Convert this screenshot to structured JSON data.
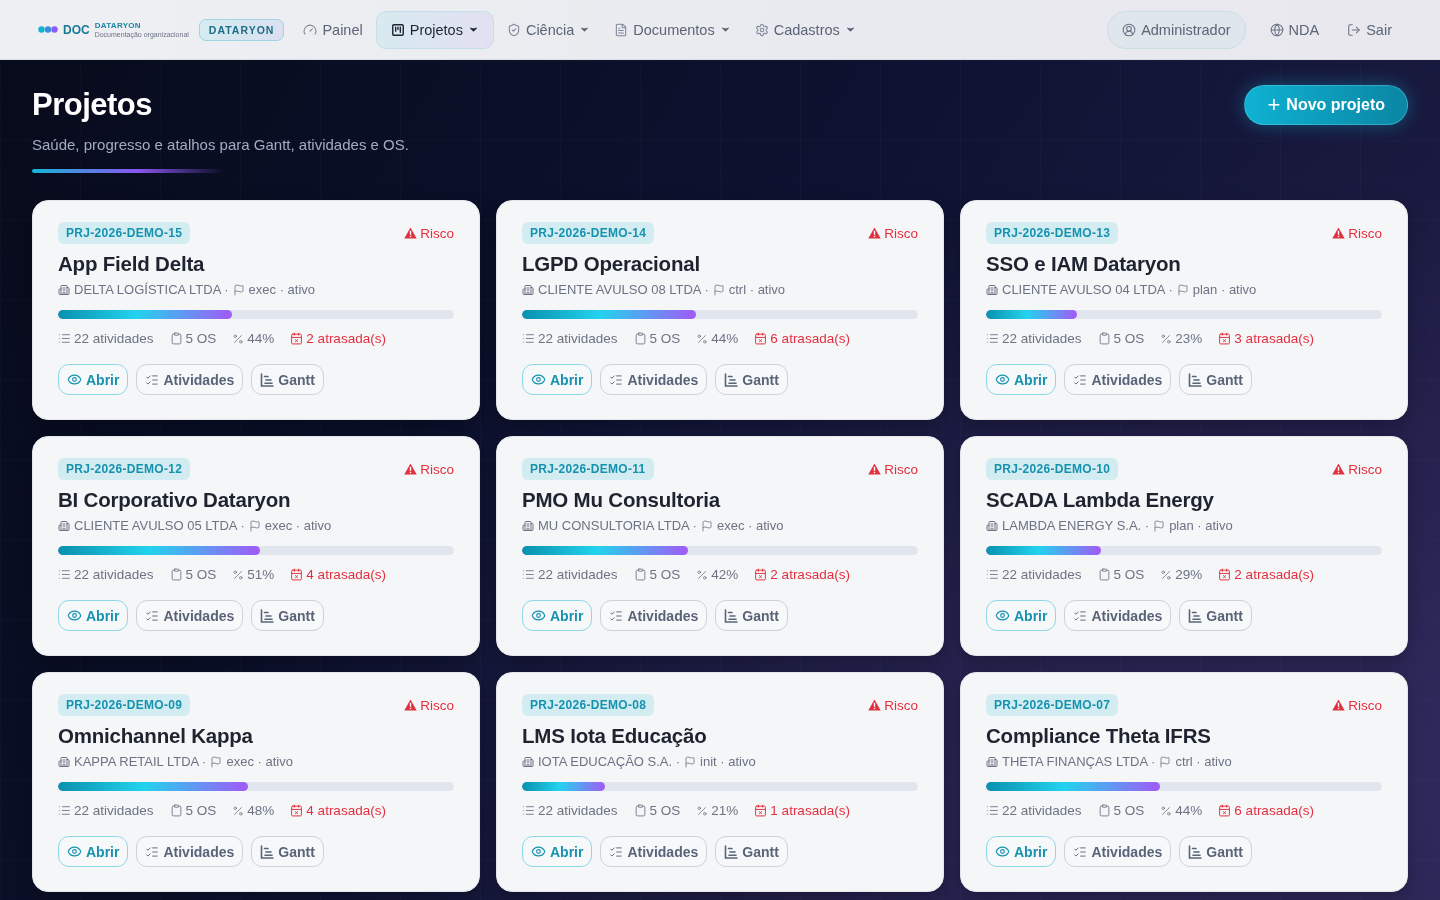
{
  "header": {
    "logo": {
      "wordmark": "DOC",
      "brand": "DATARYON",
      "tagline": "Documentação organizacional"
    },
    "badge": "DATARYON",
    "nav": [
      {
        "label": "Painel",
        "kind": "dashboard",
        "selected": false,
        "dropdown": false
      },
      {
        "label": "Projetos",
        "kind": "projects",
        "selected": true,
        "dropdown": true
      },
      {
        "label": "Ciência",
        "kind": "science",
        "selected": false,
        "dropdown": true
      },
      {
        "label": "Documentos",
        "kind": "documents",
        "selected": false,
        "dropdown": true
      },
      {
        "label": "Cadastros",
        "kind": "settings",
        "selected": false,
        "dropdown": true
      }
    ],
    "account": [
      {
        "label": "Administrador",
        "kind": "user"
      },
      {
        "label": "NDA",
        "kind": "globe"
      },
      {
        "label": "Sair",
        "kind": "logout"
      }
    ]
  },
  "page": {
    "title": "Projetos",
    "subtitle": "Saúde, progresso e atalhos para Gantt, atividades e OS.",
    "new_button": {
      "icon": "+",
      "label": "Novo projeto"
    }
  },
  "projects": [
    {
      "code": "PRJ-2026-DEMO-15",
      "risk": "Risco",
      "title": "App Field Delta",
      "client": "DELTA LOGÍSTICA LTDA ·",
      "stage": "exec · ativo",
      "level": 0.44,
      "activities": "22 atividades",
      "os": "5 OS",
      "percent": "44%",
      "late": "2 atrasada(s)",
      "actions": [
        {
          "label": "Abrir",
          "kind": "view"
        },
        {
          "label": "Atividades",
          "kind": "tasks"
        },
        {
          "label": "Gantt",
          "kind": "gantt"
        }
      ]
    },
    {
      "code": "PRJ-2026-DEMO-14",
      "risk": "Risco",
      "title": "LGPD Operacional",
      "client": "CLIENTE AVULSO 08 LTDA ·",
      "stage": "ctrl · ativo",
      "level": 0.44,
      "activities": "22 atividades",
      "os": "5 OS",
      "percent": "44%",
      "late": "6 atrasada(s)",
      "actions": [
        {
          "label": "Abrir",
          "kind": "view"
        },
        {
          "label": "Atividades",
          "kind": "tasks"
        },
        {
          "label": "Gantt",
          "kind": "gantt"
        }
      ]
    },
    {
      "code": "PRJ-2026-DEMO-13",
      "risk": "Risco",
      "title": "SSO e IAM Dataryon",
      "client": "CLIENTE AVULSO 04 LTDA ·",
      "stage": "plan · ativo",
      "level": 0.23,
      "activities": "22 atividades",
      "os": "5 OS",
      "percent": "23%",
      "late": "3 atrasada(s)",
      "actions": [
        {
          "label": "Abrir",
          "kind": "view"
        },
        {
          "label": "Atividades",
          "kind": "tasks"
        },
        {
          "label": "Gantt",
          "kind": "gantt"
        }
      ]
    },
    {
      "code": "PRJ-2026-DEMO-12",
      "risk": "Risco",
      "title": "BI Corporativo Dataryon",
      "client": "CLIENTE AVULSO 05 LTDA ·",
      "stage": "exec · ativo",
      "level": 0.51,
      "activities": "22 atividades",
      "os": "5 OS",
      "percent": "51%",
      "late": "4 atrasada(s)",
      "actions": [
        {
          "label": "Abrir",
          "kind": "view"
        },
        {
          "label": "Atividades",
          "kind": "tasks"
        },
        {
          "label": "Gantt",
          "kind": "gantt"
        }
      ]
    },
    {
      "code": "PRJ-2026-DEMO-11",
      "risk": "Risco",
      "title": "PMO Mu Consultoria",
      "client": "MU CONSULTORIA LTDA ·",
      "stage": "exec · ativo",
      "level": 0.42,
      "activities": "22 atividades",
      "os": "5 OS",
      "percent": "42%",
      "late": "2 atrasada(s)",
      "actions": [
        {
          "label": "Abrir",
          "kind": "view"
        },
        {
          "label": "Atividades",
          "kind": "tasks"
        },
        {
          "label": "Gantt",
          "kind": "gantt"
        }
      ]
    },
    {
      "code": "PRJ-2026-DEMO-10",
      "risk": "Risco",
      "title": "SCADA Lambda Energy",
      "client": "LAMBDA ENERGY S.A. ·",
      "stage": "plan · ativo",
      "level": 0.29,
      "activities": "22 atividades",
      "os": "5 OS",
      "percent": "29%",
      "late": "2 atrasada(s)",
      "actions": [
        {
          "label": "Abrir",
          "kind": "view"
        },
        {
          "label": "Atividades",
          "kind": "tasks"
        },
        {
          "label": "Gantt",
          "kind": "gantt"
        }
      ]
    },
    {
      "code": "PRJ-2026-DEMO-09",
      "risk": "Risco",
      "title": "Omnichannel Kappa",
      "client": "KAPPA RETAIL LTDA ·",
      "stage": "exec · ativo",
      "level": 0.48,
      "activities": "22 atividades",
      "os": "5 OS",
      "percent": "48%",
      "late": "4 atrasada(s)",
      "actions": [
        {
          "label": "Abrir",
          "kind": "view"
        },
        {
          "label": "Atividades",
          "kind": "tasks"
        },
        {
          "label": "Gantt",
          "kind": "gantt"
        }
      ]
    },
    {
      "code": "PRJ-2026-DEMO-08",
      "risk": "Risco",
      "title": "LMS Iota Educação",
      "client": "IOTA EDUCAÇÃO S.A. ·",
      "stage": "init · ativo",
      "level": 0.21,
      "activities": "22 atividades",
      "os": "5 OS",
      "percent": "21%",
      "late": "1 atrasada(s)",
      "actions": [
        {
          "label": "Abrir",
          "kind": "view"
        },
        {
          "label": "Atividades",
          "kind": "tasks"
        },
        {
          "label": "Gantt",
          "kind": "gantt"
        }
      ]
    },
    {
      "code": "PRJ-2026-DEMO-07",
      "risk": "Risco",
      "title": "Compliance Theta IFRS",
      "client": "THETA FINANÇAS LTDA ·",
      "stage": "ctrl · ativo",
      "level": 0.44,
      "activities": "22 atividades",
      "os": "5 OS",
      "percent": "44%",
      "late": "6 atrasada(s)",
      "actions": [
        {
          "label": "Abrir",
          "kind": "view"
        },
        {
          "label": "Atividades",
          "kind": "tasks"
        },
        {
          "label": "Gantt",
          "kind": "gantt"
        }
      ]
    }
  ]
}
